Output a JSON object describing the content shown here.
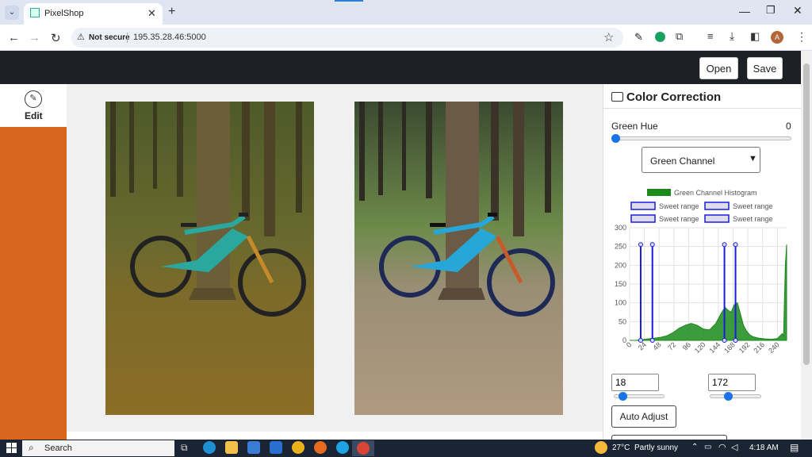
{
  "browser": {
    "tab_title": "PixelShop",
    "security_label": "Not secure",
    "url": "195.35.28.46:5000",
    "profile_initial": "A"
  },
  "app": {
    "open_label": "Open",
    "save_label": "Save",
    "nav_edit_label": "Edit"
  },
  "panel": {
    "title": "Color Correction",
    "hue_label": "Green Hue",
    "hue_value": "0",
    "channel_select": "Green Channel",
    "low_value": "18",
    "high_value": "172",
    "auto_adjust_label": "Auto Adjust"
  },
  "chart_data": {
    "type": "area",
    "title": "",
    "legend": [
      "Green Channel Histogram",
      "Sweet range",
      "Sweet range",
      "Sweet range",
      "Sweet range"
    ],
    "legend_placement": "top",
    "x_ticks": [
      "0",
      "24",
      "48",
      "72",
      "96",
      "120",
      "144",
      "168",
      "192",
      "216",
      "240"
    ],
    "y_ticks": [
      "0",
      "50",
      "100",
      "150",
      "200",
      "250",
      "300"
    ],
    "xlim": [
      0,
      255
    ],
    "ylim": [
      0,
      300
    ],
    "grid": true,
    "series": [
      {
        "name": "Green Channel Histogram",
        "color": "#1a8a1a",
        "x": [
          0,
          10,
          20,
          30,
          40,
          50,
          60,
          70,
          80,
          90,
          100,
          110,
          120,
          130,
          140,
          148,
          155,
          160,
          165,
          170,
          175,
          180,
          185,
          190,
          195,
          200,
          210,
          220,
          230,
          240,
          248,
          250,
          253,
          255
        ],
        "values": [
          0,
          0,
          2,
          4,
          6,
          8,
          12,
          20,
          32,
          40,
          45,
          40,
          30,
          28,
          45,
          70,
          88,
          80,
          75,
          95,
          100,
          70,
          40,
          25,
          15,
          10,
          6,
          4,
          3,
          5,
          18,
          10,
          200,
          255
        ]
      }
    ],
    "sweet_ranges": [
      [
        18,
        0
      ],
      [
        37,
        0
      ],
      [
        154,
        0
      ],
      [
        172,
        0
      ]
    ],
    "sweet_range_top": 255
  },
  "taskbar": {
    "search_label": "Search",
    "weather_temp": "27°C",
    "weather_text": "Partly sunny",
    "time": "4:18 AM"
  }
}
